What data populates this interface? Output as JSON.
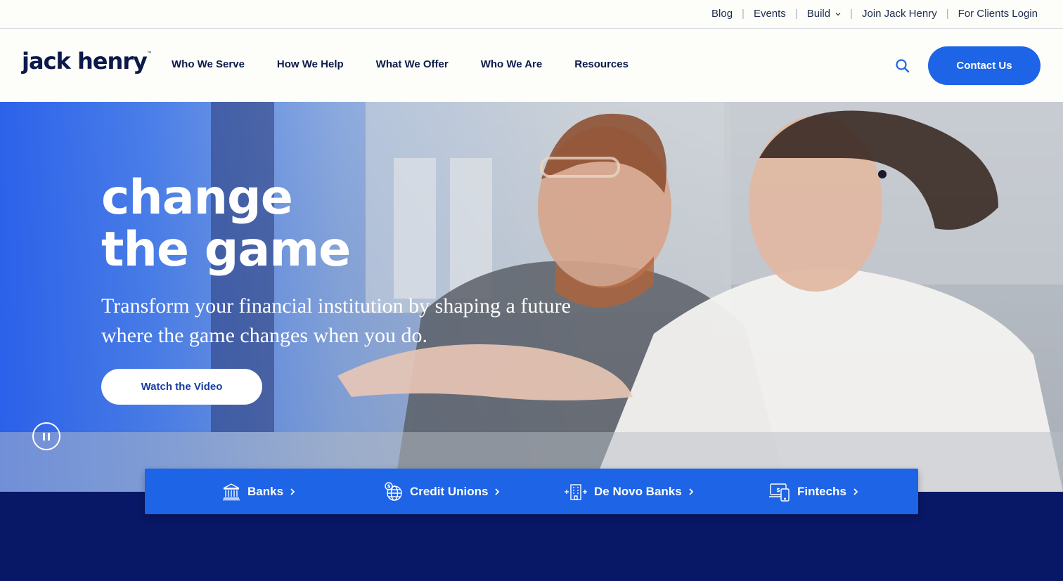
{
  "utility": {
    "links": [
      "Blog",
      "Events",
      "Build",
      "Join Jack Henry",
      "For Clients Login"
    ]
  },
  "brand": {
    "logo_text": "jack henry",
    "tm": "™"
  },
  "nav": {
    "items": [
      "Who We Serve",
      "How We Help",
      "What We Offer",
      "Who We Are",
      "Resources"
    ],
    "contact_label": "Contact Us",
    "search_icon": "search-icon"
  },
  "hero": {
    "title_line1": "change",
    "title_line2": "the game",
    "subtitle": "Transform your financial institution by shaping a future where the game changes when you do.",
    "watch_label": "Watch the Video",
    "pause_icon": "pause-icon"
  },
  "segments": [
    {
      "label": "Banks",
      "icon": "bank-icon"
    },
    {
      "label": "Credit Unions",
      "icon": "globe-dollar-icon"
    },
    {
      "label": "De Novo Banks",
      "icon": "new-building-icon"
    },
    {
      "label": "Fintechs",
      "icon": "devices-dollar-icon"
    }
  ],
  "colors": {
    "brand_blue": "#1d64e6",
    "navy": "#0b1a4a",
    "band_navy": "#081866",
    "page_bg": "#fdfdf9"
  }
}
